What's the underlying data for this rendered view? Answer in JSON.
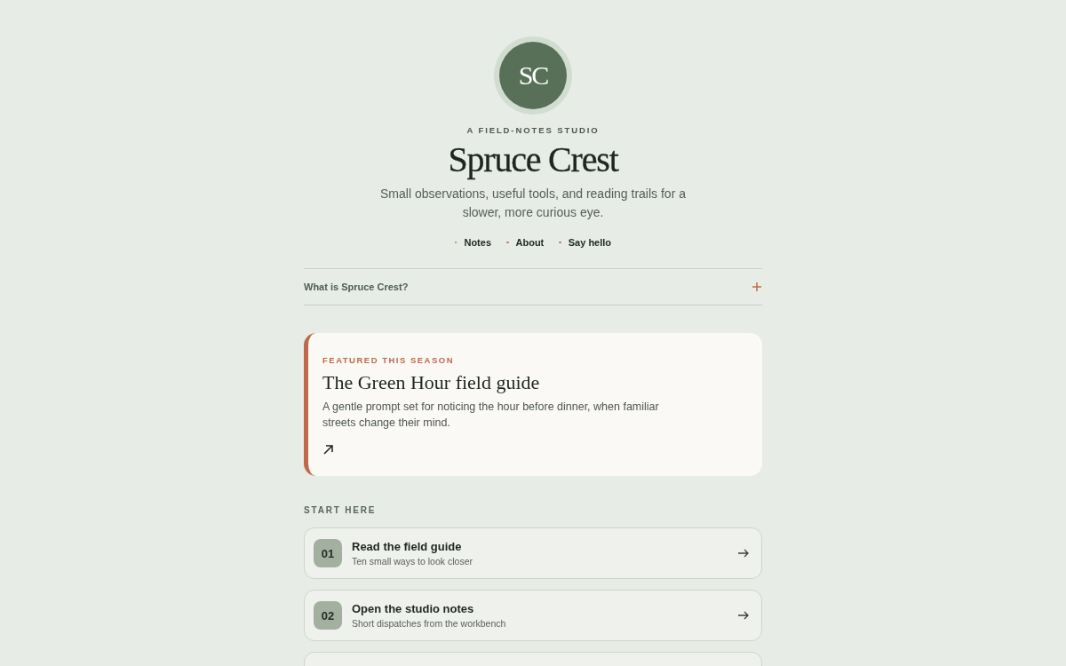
{
  "header": {
    "logo_initials": "SC",
    "eyebrow": "A FIELD-NOTES STUDIO",
    "title": "Spruce Crest",
    "tagline": "Small observations, useful tools, and reading trails for a slower, more curious eye."
  },
  "nav": [
    {
      "label": "Notes"
    },
    {
      "label": "About"
    },
    {
      "label": "Say hello"
    }
  ],
  "faq": [
    {
      "question": "What is Spruce Crest?",
      "expanded": false
    }
  ],
  "featured": {
    "eyebrow": "FEATURED THIS SEASON",
    "title": "The Green Hour field guide",
    "description": "A gentle prompt set for noticing the hour before dinner, when familiar streets change their mind."
  },
  "start_here": {
    "heading": "START HERE",
    "items": [
      {
        "kind": "full",
        "number": "01",
        "title": "Read the field guide",
        "subtitle": "Ten small ways to look closer"
      },
      {
        "kind": "full",
        "number": "02",
        "title": "Open the studio notes",
        "subtitle": "Short dispatches from the workbench"
      },
      {
        "kind": "cut"
      }
    ]
  }
}
